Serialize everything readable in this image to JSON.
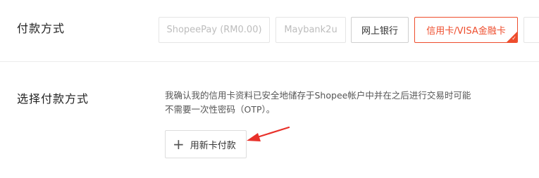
{
  "payment": {
    "title": "付款方式",
    "methods": [
      "ShopeePay (RM0.00)",
      "Maybank2u",
      "网上银行",
      "信用卡/VISA金融卡",
      ""
    ],
    "selected_index": 3,
    "selected_check": "✓"
  },
  "choose": {
    "title": "选择付款方式",
    "notice": "我确认我的信用卡资料已安全地储存于Shopee帐户中并在之后进行交易时可能不需要一次性密码（OTP）。",
    "add_card_icon": "+",
    "add_card_label": "用新卡付款"
  },
  "colors": {
    "accent": "#ee4d2d",
    "annotation_arrow": "#e8312a"
  }
}
